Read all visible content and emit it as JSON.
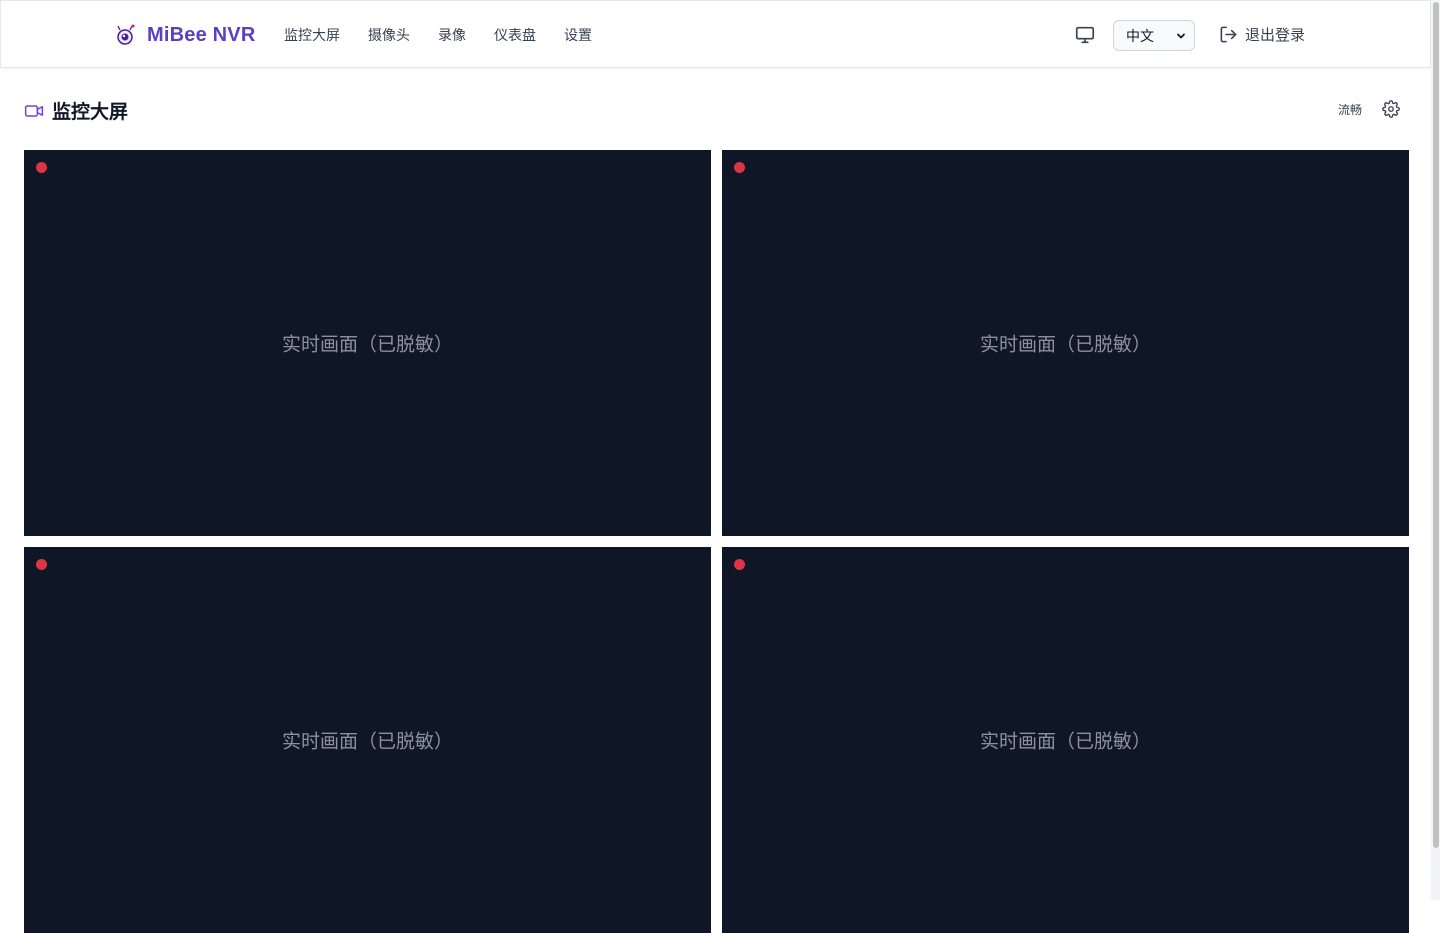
{
  "app": {
    "name": "MiBee NVR"
  },
  "nav": {
    "items": [
      {
        "label": "监控大屏"
      },
      {
        "label": "摄像头"
      },
      {
        "label": "录像"
      },
      {
        "label": "仪表盘"
      },
      {
        "label": "设置"
      }
    ]
  },
  "header": {
    "language": {
      "selected": "中文"
    },
    "logout_label": "退出登录"
  },
  "page": {
    "title": "监控大屏",
    "quality_label": "流畅"
  },
  "cameras": [
    {
      "feed_text": "实时画面（已脱敏）"
    },
    {
      "feed_text": "实时画面（已脱敏）"
    },
    {
      "feed_text": "实时画面（已脱敏）"
    },
    {
      "feed_text": "实时画面（已脱敏）"
    }
  ],
  "colors": {
    "brand": "#5b3fc4",
    "tile_background": "#0f1726",
    "recording_dot": "#dc3545"
  },
  "icons": [
    "bee-logo-icon",
    "monitor-icon",
    "chevron-down-icon",
    "logout-icon",
    "video-camera-icon",
    "gear-icon"
  ]
}
